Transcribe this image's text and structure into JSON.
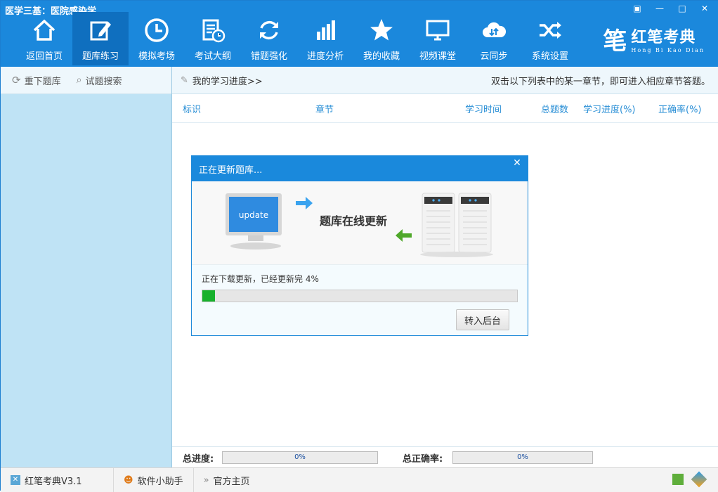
{
  "window": {
    "title": "医学三基：医院感染学"
  },
  "nav": [
    {
      "label": "返回首页",
      "icon": "home-icon"
    },
    {
      "label": "题库练习",
      "icon": "edit-icon"
    },
    {
      "label": "模拟考场",
      "icon": "clock-icon"
    },
    {
      "label": "考试大纲",
      "icon": "syllabus-icon"
    },
    {
      "label": "错题强化",
      "icon": "refresh-icon"
    },
    {
      "label": "进度分析",
      "icon": "bar-chart-icon"
    },
    {
      "label": "我的收藏",
      "icon": "star-icon"
    },
    {
      "label": "视频课堂",
      "icon": "monitor-icon"
    },
    {
      "label": "云同步",
      "icon": "cloud-sync-icon"
    },
    {
      "label": "系统设置",
      "icon": "shuffle-icon"
    }
  ],
  "active_nav": "题库练习",
  "brand": {
    "name": "红笔考典",
    "pinyin": "Hong Bi Kao Dian"
  },
  "left": {
    "reload_label": "重下题库",
    "search_label": "试题搜索"
  },
  "main": {
    "breadcrumb": "我的学习进度>>",
    "hint": "双击以下列表中的某一章节，即可进入相应章节答题。",
    "columns": [
      "标识",
      "章节",
      "学习时间",
      "总题数",
      "学习进度(%)",
      "正确率(%)"
    ]
  },
  "dialog": {
    "title": "正在更新题库...",
    "banner_text": "题库在线更新",
    "monitor_text": "update",
    "message": "正在下载更新，已经更新完 4%",
    "progress_value": 0.04,
    "button_label": "转入后台"
  },
  "stats": {
    "total_progress_label": "总进度:",
    "total_progress_value": "0%",
    "total_accuracy_label": "总正确率:",
    "total_accuracy_value": "0%"
  },
  "statusbar": {
    "version": "红笔考典V3.1",
    "helper": "软件小助手",
    "homepage": "官方主页"
  },
  "colors": {
    "accent": "#1b88dc",
    "progress": "#17b12c",
    "sidebar": "#bfe3f5"
  }
}
